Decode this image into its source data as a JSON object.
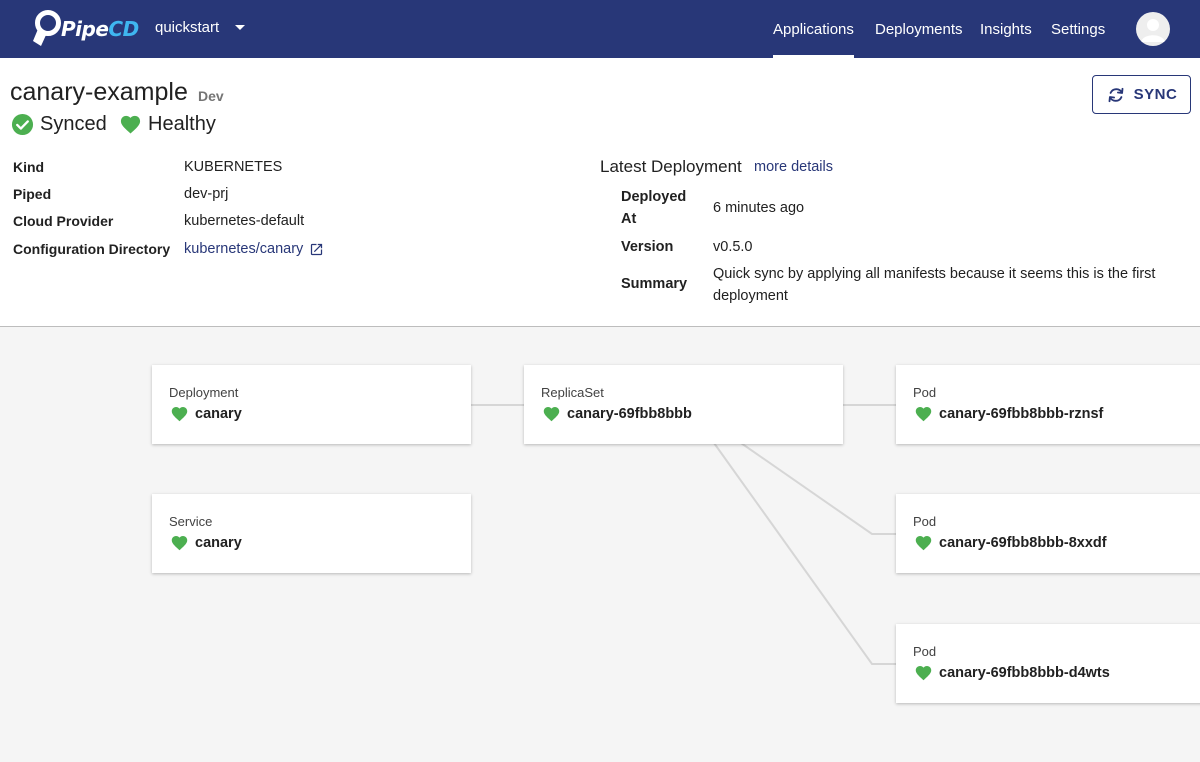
{
  "header": {
    "logo": {
      "part1": "Pipe",
      "part2": "CD"
    },
    "project": "quickstart",
    "nav": [
      "Applications",
      "Deployments",
      "Insights",
      "Settings"
    ],
    "active_nav": "Applications",
    "avatar_icon": "account-circle-icon"
  },
  "app": {
    "name": "canary-example",
    "env": "Dev",
    "sync_status": "Synced",
    "health_status": "Healthy",
    "sync_button": "SYNC",
    "info": [
      {
        "label": "Kind",
        "value": "KUBERNETES"
      },
      {
        "label": "Piped",
        "value": "dev-prj"
      },
      {
        "label": "Cloud Provider",
        "value": "kubernetes-default"
      },
      {
        "label": "Configuration Directory",
        "value": "kubernetes/canary"
      }
    ]
  },
  "latest_deployment": {
    "title": "Latest Deployment",
    "link": "more details",
    "rows": [
      {
        "label_line1": "Deployed",
        "label_line2": "At",
        "value": "6 minutes ago"
      },
      {
        "label": "Version",
        "value": "v0.5.0"
      },
      {
        "label": "Summary",
        "value_line1": "Quick sync by applying all manifests because it seems this is the first",
        "value_line2": "deployment"
      }
    ]
  },
  "resources": [
    {
      "kind": "Deployment",
      "name": "canary",
      "health": "healthy"
    },
    {
      "kind": "Service",
      "name": "canary",
      "health": "healthy"
    },
    {
      "kind": "ReplicaSet",
      "name": "canary-69fbb8bbb",
      "health": "healthy"
    },
    {
      "kind": "Pod",
      "name": "canary-69fbb8bbb-rznsf",
      "health": "healthy"
    },
    {
      "kind": "Pod",
      "name": "canary-69fbb8bbb-8xxdf",
      "health": "healthy"
    },
    {
      "kind": "Pod",
      "name": "canary-69fbb8bbb-d4wts",
      "health": "healthy"
    }
  ],
  "colors": {
    "primary": "#283778",
    "accent": "#3fb6f0",
    "healthy": "#4caf50",
    "edge": "#d6d6d6"
  }
}
